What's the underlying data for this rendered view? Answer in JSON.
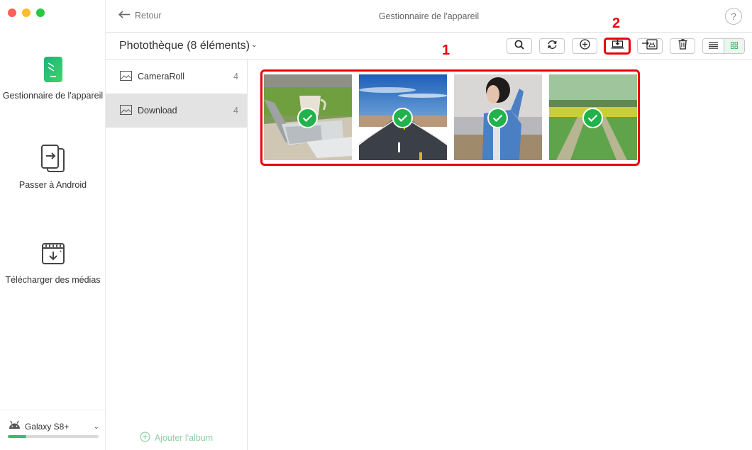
{
  "window": {
    "title": "Gestionnaire de l'appareil",
    "back_label": "Retour",
    "help_label": "?"
  },
  "sidebar": {
    "items": [
      {
        "label": "Gestionnaire de l'appareil",
        "icon": "phone-manager-icon",
        "active": true
      },
      {
        "label": "Passer à Android",
        "icon": "switch-to-android-icon",
        "active": false
      },
      {
        "label": "Télécharger des médias",
        "icon": "download-media-icon",
        "active": false
      }
    ],
    "device": {
      "name": "Galaxy S8+",
      "icon": "android-icon",
      "storage_used_fraction": 0.2
    }
  },
  "toolbar": {
    "library_title": "Photothèque (8 éléments)",
    "caret": "⌄",
    "buttons": [
      {
        "name": "search",
        "icon": "search-icon"
      },
      {
        "name": "refresh",
        "icon": "refresh-icon"
      },
      {
        "name": "add",
        "icon": "add-icon"
      },
      {
        "name": "export-to-computer",
        "icon": "export-icon",
        "highlighted": true
      },
      {
        "name": "send-to-device",
        "icon": "send-to-device-icon"
      },
      {
        "name": "delete",
        "icon": "trash-icon"
      }
    ],
    "view_modes": [
      {
        "name": "list",
        "icon": "list-view-icon",
        "active": false
      },
      {
        "name": "grid",
        "icon": "grid-view-icon",
        "active": true
      }
    ]
  },
  "albums": {
    "items": [
      {
        "name": "CameraRoll",
        "count": "4",
        "selected": false
      },
      {
        "name": "Download",
        "count": "4",
        "selected": true
      }
    ],
    "add_label": "Ajouter l'album"
  },
  "photos": [
    {
      "subject": "laptop and coffee cup on table",
      "selected": true
    },
    {
      "subject": "desert road under blue sky",
      "selected": true
    },
    {
      "subject": "young man in blue shirt",
      "selected": true
    },
    {
      "subject": "path through rapeseed field",
      "selected": true
    }
  ],
  "annotations": {
    "step1": "1",
    "step2": "2"
  },
  "colors": {
    "accent_green": "#22b24c",
    "annotation_red": "#e8000b"
  }
}
